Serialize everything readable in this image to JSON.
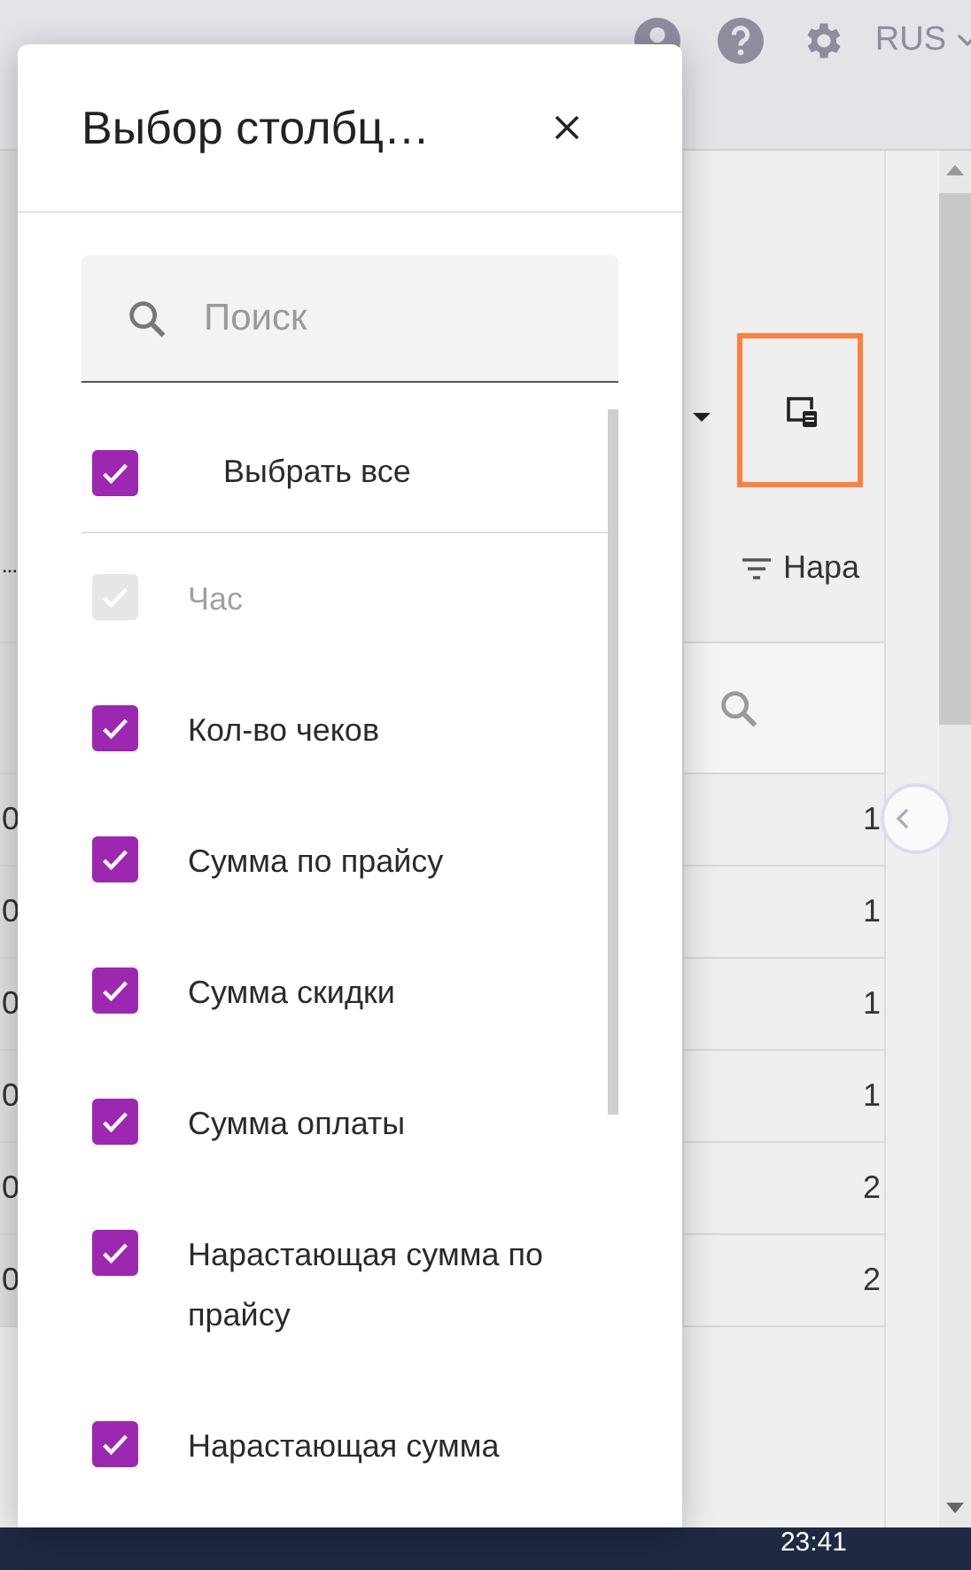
{
  "header": {
    "language": "RUS"
  },
  "toolbar": {
    "column_settings_selected": true
  },
  "table": {
    "header": {
      "column_1": "…",
      "column_2": "Нара"
    },
    "rows": [
      {
        "column_1": "0",
        "column_2": "1"
      },
      {
        "column_1": "0",
        "column_2": "1"
      },
      {
        "column_1": "0",
        "column_2": "1"
      },
      {
        "column_1": "0",
        "column_2": "1"
      },
      {
        "column_1": "0",
        "column_2": "2"
      },
      {
        "column_1": "0",
        "column_2": "2"
      }
    ]
  },
  "dialog": {
    "title": "Выбор столбц…",
    "search": {
      "placeholder": "Поиск"
    },
    "select_all": {
      "label": "Выбрать все",
      "checked": true
    },
    "items": [
      {
        "label": "Час",
        "checked": true,
        "disabled": true
      },
      {
        "label": "Кол-во чеков",
        "checked": true,
        "disabled": false
      },
      {
        "label": "Сумма по прайсу",
        "checked": true,
        "disabled": false
      },
      {
        "label": "Сумма скидки",
        "checked": true,
        "disabled": false
      },
      {
        "label": "Сумма оплаты",
        "checked": true,
        "disabled": false
      },
      {
        "label": "Нарастающая сумма по прайсу",
        "checked": true,
        "disabled": false
      },
      {
        "label": "Нарастающая сумма",
        "checked": true,
        "disabled": false
      }
    ]
  },
  "taskbar": {
    "time": "23:41"
  }
}
